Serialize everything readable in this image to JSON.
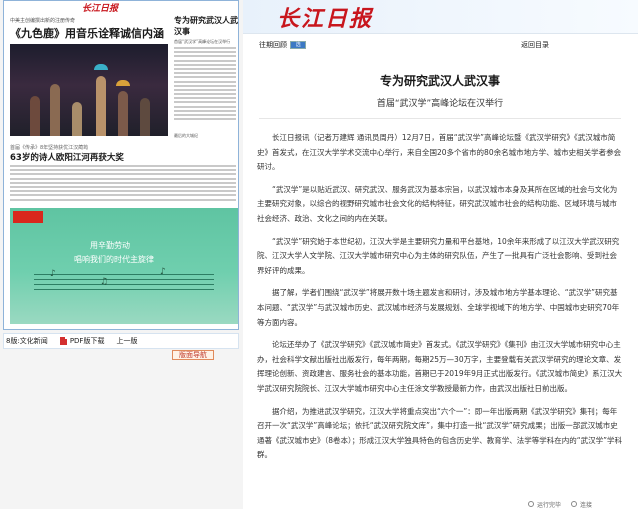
{
  "paper": {
    "masthead_red": "长江日报",
    "kicker": "中美主创编撰出新的注册传奇",
    "title": "《九色鹿》用音乐诠释诚信内涵",
    "subkicker": "首届《传承》8年坚持获优江汉蔺筠",
    "title2": "63岁的诗人欧阳江河再获大奖",
    "right_title": "专为研究武汉人武汉事",
    "right_sub": "首届“武汉学”高峰论坛在汉举行",
    "right_sub2": "最后的大城纪",
    "banner_text1": "用辛勤劳动",
    "banner_text2": "唱响我们的时代主旋律"
  },
  "pagenav": {
    "section": "8版:文化新闻",
    "pdf": "PDF版下载",
    "prev": "上一版",
    "nav_button": "版面导航"
  },
  "masthead": {
    "logo": "长江日报"
  },
  "toolbar": {
    "back_label": "往期回顾",
    "select_value": "选",
    "contents_label": "返回目录"
  },
  "article": {
    "title": "专为研究武汉人武汉事",
    "subtitle": "首届“武汉学”高峰论坛在汉举行",
    "paragraphs": [
      "长江日报讯（记者万建辉 通讯员周丹）12月7日，首届“武汉学”高峰论坛暨《武汉学研究》《武汉城市简史》首发式，在江汉大学学术交流中心举行，来自全国20多个省市的80余名城市地方学、城市史相关学者参会研讨。",
      "“武汉学”是以贴近武汉、研究武汉、服务武汉为基本宗旨，以武汉城市本身及其所在区域的社会与文化为主要研究对象，以综合的视野研究城市社会文化的结构特征，研究武汉城市社会的结构功能、区域环境与城市社会经济、政治、文化之间的内在关联。",
      "“武汉学”研究始于本世纪初，江汉大学是主要研究力量和平台基地，10余年来形成了以江汉大学武汉研究院、江汉大学人文学院、江汉大学城市研究中心为主体的研究队伍，产生了一批具有广泛社会影响、受到社会界好评的成果。",
      "据了解，学者们围绕“武汉学”将展开数十场主题发言和研讨，涉及城市地方学基本理论、“武汉学”研究基本问题、“武汉学”与武汉城市历史、武汉城市经济与发展规划、全球学视域下的地方学、中国城市史研究70年等方面内容。",
      "论坛还举办了《武汉学研究》《武汉城市简史》首发式。《武汉学研究》《集刊》由江汉大学城市研究中心主办，社会科学文献出版社出版发行，每年两期，每期25万—30万字，主要登载有关武汉学研究的理论文章、发挥理论创新、资政建言、服务社会的基本功能，首期已于2019年9月正式出版发行。《武汉城市简史》系江汉大学武汉研究院院长、江汉大学城市研究中心主任涂文学教授最新力作，由武汉出版社日前出版。",
      "据介绍，为推进武汉学研究，江汉大学将重点突出“六个一”：即一年出版两期《武汉学研究》集刊；每年召开一次“武汉学”高峰论坛；依托“武汉研究院文库”，集中打造一批“武汉学”研究成果；出版一部武汉城市史通著《武汉城市史》（8卷本）；形成江汉大学独具特色的包含历史学、教育学、法学等学科在内的“武汉学”学科群。"
    ]
  },
  "status": {
    "item1": "运行完毕",
    "item2": "连接"
  }
}
